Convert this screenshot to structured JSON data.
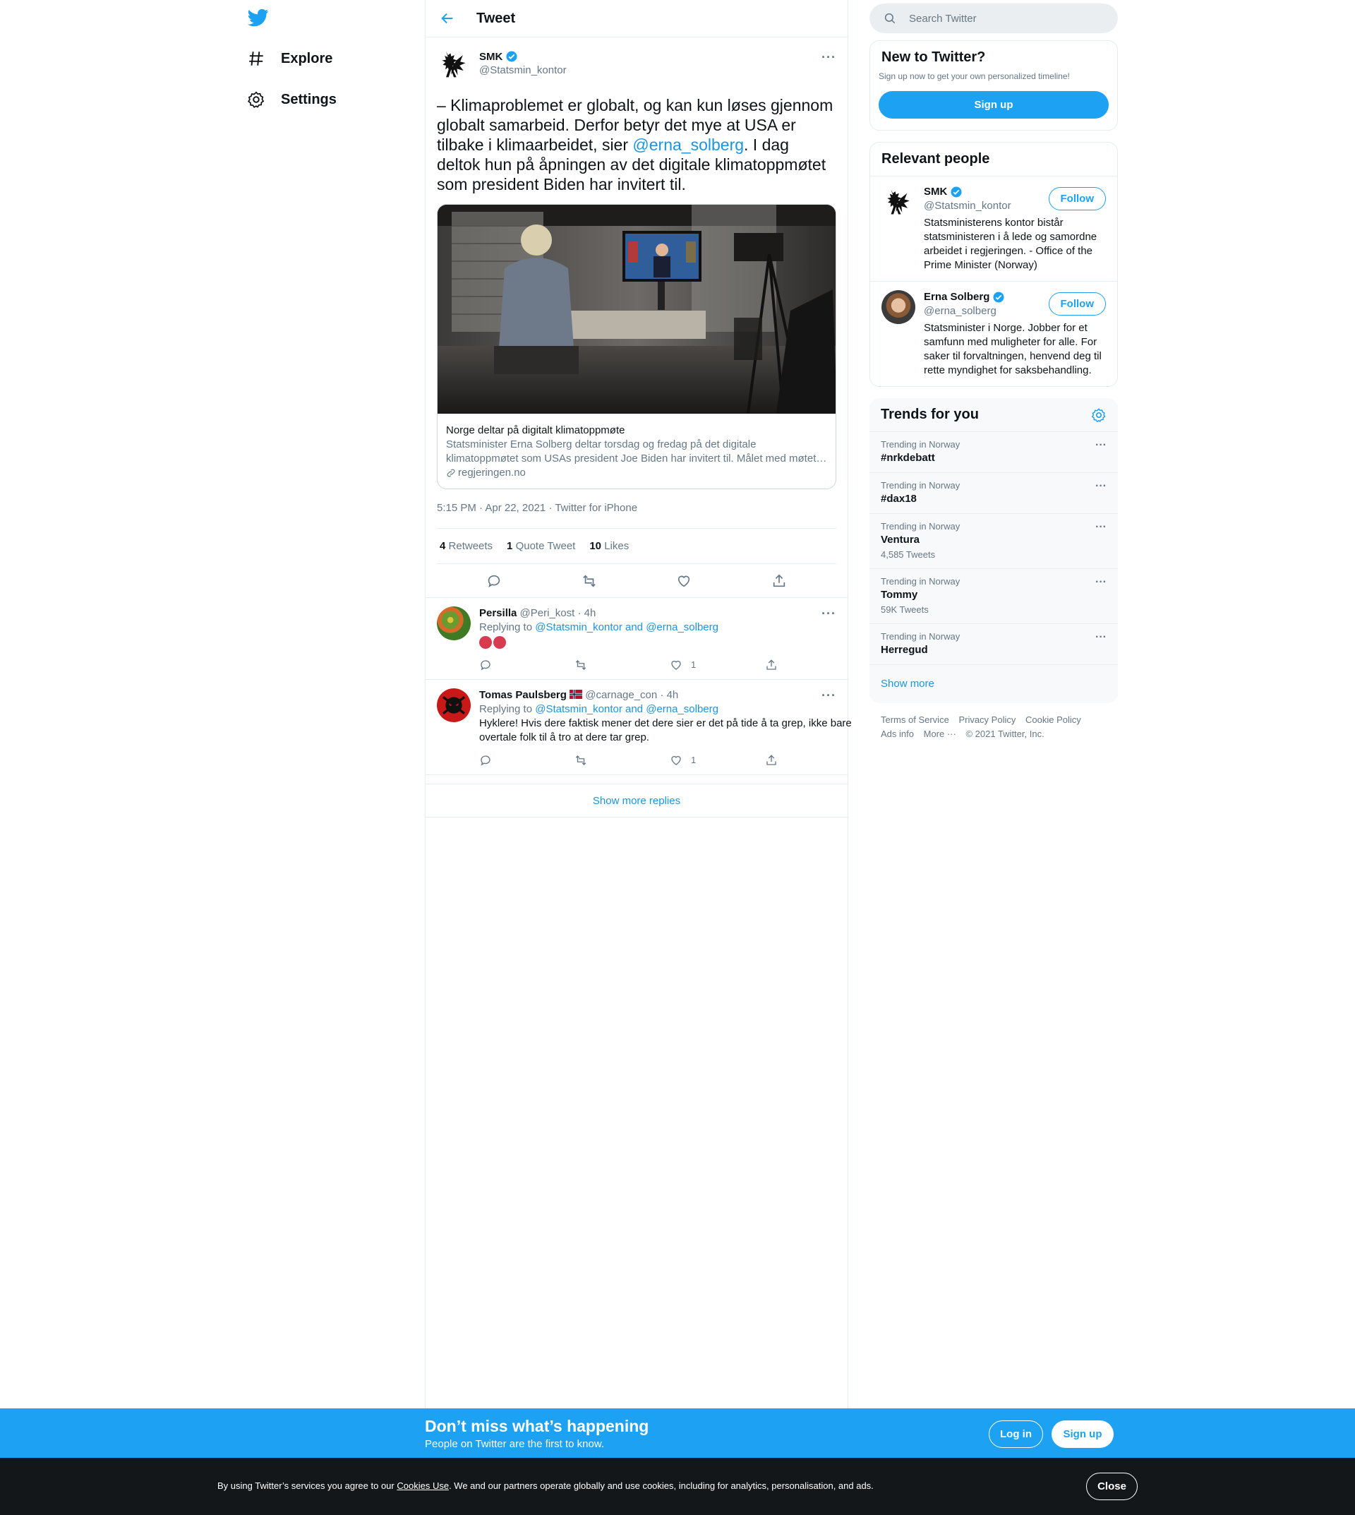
{
  "nav": {
    "explore": "Explore",
    "settings": "Settings"
  },
  "header": {
    "title": "Tweet"
  },
  "tweet": {
    "author_name": "SMK",
    "author_handle": "@Statsmin_kontor",
    "text_before": "– Klimaproblemet er globalt, og kan kun løses gjennom globalt samarbeid. Derfor betyr det mye at USA er tilbake i klimaarbeidet, sier ",
    "mention": "@erna_solberg",
    "text_after": ". I dag deltok hun på åpningen av det digitale klimatoppmøtet som president Biden har invitert til.",
    "card_title": "Norge deltar på digitalt klimatoppmøte",
    "card_desc": "Statsminister Erna Solberg deltar torsdag og fredag på det digitale klimatoppmøtet som USAs president Joe Biden har invitert til. Målet med møtet…",
    "card_domain": "regjeringen.no",
    "timestamp": "5:15 PM · Apr 22, 2021 · Twitter for iPhone",
    "retweets_count": "4",
    "retweets_label": "Retweets",
    "quotes_count": "1",
    "quotes_label": "Quote Tweet",
    "likes_count": "10",
    "likes_label": "Likes"
  },
  "replies": [
    {
      "name": "Persilla",
      "handle": "@Peri_kost",
      "time": "· 4h",
      "replying_prefix": "Replying to",
      "replying_to": "@Statsmin_kontor and @erna_solberg",
      "text": "",
      "likes": "1"
    },
    {
      "name": "Tomas Paulsberg",
      "handle": "@carnage_con",
      "time": "· 4h",
      "replying_prefix": "Replying to",
      "replying_to": "@Statsmin_kontor and @erna_solberg",
      "text": "Hyklere! Hvis dere faktisk mener det dere sier er det på tide å ta grep, ikke bare overtale folk til å tro at dere tar grep.",
      "likes": "1"
    }
  ],
  "show_more_replies": "Show more replies",
  "search": {
    "placeholder": "Search Twitter"
  },
  "new_to_twitter": {
    "title": "New to Twitter?",
    "subtitle": "Sign up now to get your own personalized timeline!",
    "button": "Sign up"
  },
  "relevant_people": {
    "title": "Relevant people",
    "people": [
      {
        "name": "SMK",
        "handle": "@Statsmin_kontor",
        "bio": "Statsministerens kontor bistår statsministeren i å lede og samordne arbeidet i regjeringen. - Office of the Prime Minister (Norway)",
        "follow": "Follow"
      },
      {
        "name": "Erna Solberg",
        "handle": "@erna_solberg",
        "bio": "Statsminister i Norge. Jobber for et samfunn med muligheter for alle. For saker til forvaltningen, henvend deg til rette myndighet for saksbehandling.",
        "follow": "Follow"
      }
    ]
  },
  "trends": {
    "title": "Trends for you",
    "items": [
      {
        "context": "Trending in Norway",
        "name": "#nrkdebatt",
        "count": ""
      },
      {
        "context": "Trending in Norway",
        "name": "#dax18",
        "count": ""
      },
      {
        "context": "Trending in Norway",
        "name": "Ventura",
        "count": "4,585 Tweets"
      },
      {
        "context": "Trending in Norway",
        "name": "Tommy",
        "count": "59K Tweets"
      },
      {
        "context": "Trending in Norway",
        "name": "Herregud",
        "count": ""
      }
    ],
    "show_more": "Show more"
  },
  "footer": {
    "terms": "Terms of Service",
    "privacy": "Privacy Policy",
    "cookie": "Cookie Policy",
    "ads": "Ads info",
    "more": "More ···",
    "copyright": "© 2021 Twitter, Inc."
  },
  "banner": {
    "title": "Don’t miss what’s happening",
    "subtitle": "People on Twitter are the first to know.",
    "login": "Log in",
    "signup": "Sign up"
  },
  "cookie_bar": {
    "text_before": "By using Twitter’s services you agree to our ",
    "link": "Cookies Use",
    "text_after": ". We and our partners operate globally and use cookies, including for analytics, personalisation, and ads.",
    "close": "Close"
  },
  "colors": {
    "accent": "#1da1f2",
    "link": "#1b95e0",
    "muted": "#657786",
    "cookie_bg": "#14171a"
  }
}
